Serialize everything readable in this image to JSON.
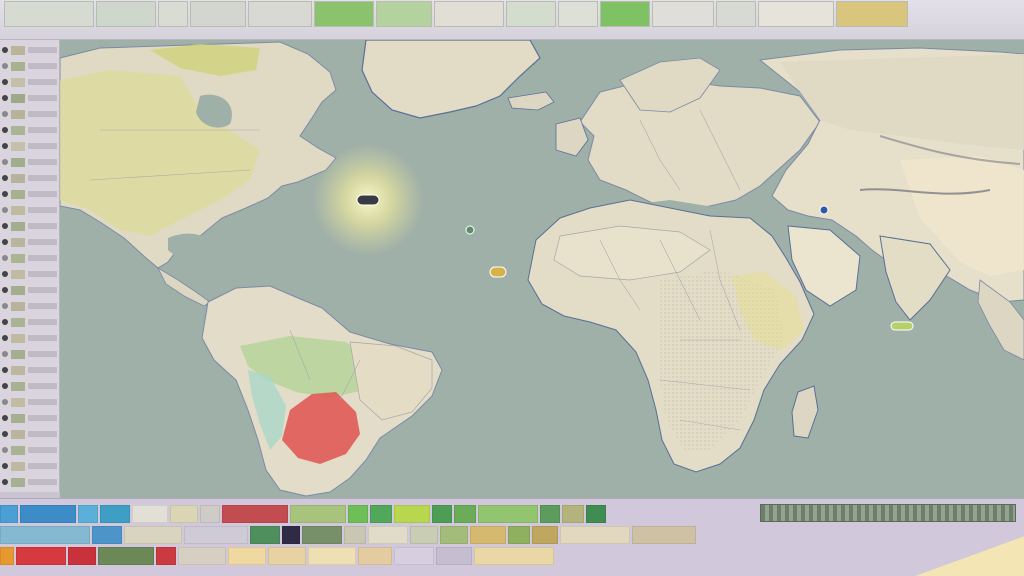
{
  "toolbar": {
    "buttons": [
      {
        "name": "tool-1",
        "color": "#d5dbd1"
      },
      {
        "name": "tool-2",
        "color": "#cfd6cb"
      },
      {
        "name": "tool-3",
        "color": "#d8dcd3"
      },
      {
        "name": "tool-4",
        "color": "#d3d6cf"
      },
      {
        "name": "tool-5",
        "color": "#d7d9d2"
      },
      {
        "name": "tool-6",
        "color": "#8bc26d"
      },
      {
        "name": "tool-7",
        "color": "#b4d29d"
      },
      {
        "name": "tool-8",
        "color": "#e1ded6"
      },
      {
        "name": "tool-9",
        "color": "#d4dcce"
      },
      {
        "name": "tool-10",
        "color": "#dde0d7"
      },
      {
        "name": "tool-11",
        "color": "#7ec264"
      },
      {
        "name": "tool-12",
        "color": "#e0ded8"
      },
      {
        "name": "tool-13",
        "color": "#d6dad2"
      },
      {
        "name": "tool-14",
        "color": "#e6e4da"
      },
      {
        "name": "tool-15",
        "color": "#d9c57e"
      }
    ]
  },
  "legend": {
    "row1": [
      {
        "color": "#4a9fd6",
        "label": ""
      },
      {
        "color": "#3c8cc8",
        "label": ""
      },
      {
        "color": "#5bb0d9",
        "label": ""
      },
      {
        "color": "#3e9fc4",
        "label": ""
      },
      {
        "color": "#e2e0d6",
        "label": ""
      },
      {
        "color": "#d9d5b5",
        "label": ""
      },
      {
        "color": "#cfcbc6",
        "label": ""
      },
      {
        "color": "#c24c50",
        "label": ""
      },
      {
        "color": "#a8c47c",
        "label": ""
      },
      {
        "color": "#6fbf58",
        "label": ""
      },
      {
        "color": "#52a85a",
        "label": ""
      },
      {
        "color": "#b8d74e",
        "label": ""
      },
      {
        "color": "#4e9d54",
        "label": ""
      },
      {
        "color": "#6aac58",
        "label": ""
      },
      {
        "color": "#93c571",
        "label": ""
      },
      {
        "color": "#5c9d5e",
        "label": ""
      },
      {
        "color": "#b5b37c",
        "label": ""
      },
      {
        "color": "#3f8d50",
        "label": ""
      }
    ],
    "row2": [
      {
        "color": "#85b9d2",
        "label": ""
      },
      {
        "color": "#4d95c8",
        "label": ""
      },
      {
        "color": "#d9d4c0",
        "label": ""
      },
      {
        "color": "#cfcbd6",
        "label": ""
      },
      {
        "color": "#4f8e5d",
        "label": ""
      },
      {
        "color": "#2f2b46",
        "label": ""
      },
      {
        "color": "#77906a",
        "label": ""
      },
      {
        "color": "#c9c6b4",
        "label": ""
      },
      {
        "color": "#e0dcc9",
        "label": ""
      },
      {
        "color": "#c9cdb3",
        "label": ""
      },
      {
        "color": "#a4bc79",
        "label": ""
      },
      {
        "color": "#d5b96f",
        "label": ""
      },
      {
        "color": "#8fb05e",
        "label": ""
      },
      {
        "color": "#bfa760",
        "label": ""
      },
      {
        "color": "#e2d8c0",
        "label": ""
      },
      {
        "color": "#cfc1a4",
        "label": ""
      }
    ],
    "row3": [
      {
        "color": "#e5992f",
        "label": ""
      },
      {
        "color": "#d63a3f",
        "label": ""
      },
      {
        "color": "#c9323b",
        "label": ""
      },
      {
        "color": "#6d8857",
        "label": ""
      },
      {
        "color": "#cc3a41",
        "label": ""
      },
      {
        "color": "#d8cfc3",
        "label": ""
      },
      {
        "color": "#f0d9a0",
        "label": ""
      },
      {
        "color": "#e7d2a1",
        "label": ""
      },
      {
        "color": "#efe0b4",
        "label": ""
      },
      {
        "color": "#e4cba0",
        "label": ""
      },
      {
        "color": "#d5cfe0",
        "label": ""
      },
      {
        "color": "#c5bed0",
        "label": ""
      },
      {
        "color": "#ead7a6",
        "label": ""
      }
    ]
  },
  "map": {
    "colors": {
      "ocean": "#9fb0a9",
      "land": "#ddd6c3",
      "land_alt": "#e8e1cc",
      "border": "#a7a6a8",
      "coast": "#5b6f96",
      "highlight_red": "#e05b57",
      "highlight_green": "#b6d39a",
      "highlight_yellow": "#e7df8a",
      "sun_glow": "#fff6b0"
    },
    "markers": [
      {
        "name": "atlantic-ship-marker"
      },
      {
        "name": "west-africa-marker"
      },
      {
        "name": "mid-atlantic-marker"
      },
      {
        "name": "middle-east-marker"
      },
      {
        "name": "arabian-sea-marker"
      }
    ]
  }
}
